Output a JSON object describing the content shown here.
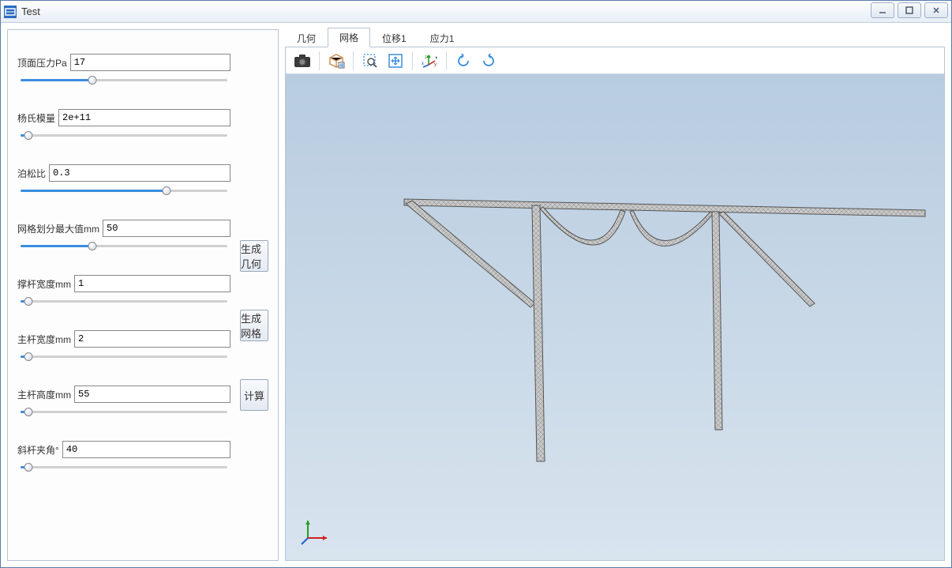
{
  "window": {
    "title": "Test"
  },
  "params": {
    "pressure": {
      "label": "顶面压力Pa",
      "value": "17",
      "fill": 35
    },
    "youngs": {
      "label": "杨氏模量",
      "value": "2e+11",
      "fill": 5
    },
    "poisson": {
      "label": "泊松比",
      "value": "0.3",
      "fill": 70
    },
    "meshmax": {
      "label": "网格划分最大值mm",
      "value": "50",
      "fill": 35
    },
    "bracewidth": {
      "label": "撑杆宽度mm",
      "value": "1",
      "fill": 5
    },
    "mainwidth": {
      "label": "主杆宽度mm",
      "value": "2",
      "fill": 5
    },
    "mainheight": {
      "label": "主杆高度mm",
      "value": "55",
      "fill": 5
    },
    "angle": {
      "label": "斜杆夹角°",
      "value": "40",
      "fill": 5
    }
  },
  "buttons": {
    "gen_geom": "生成几何",
    "gen_mesh": "生成网格",
    "compute": "计算"
  },
  "tabs": {
    "geometry": "几何",
    "mesh": "网格",
    "disp1": "位移1",
    "stress1": "应力1"
  },
  "active_tab": "mesh"
}
